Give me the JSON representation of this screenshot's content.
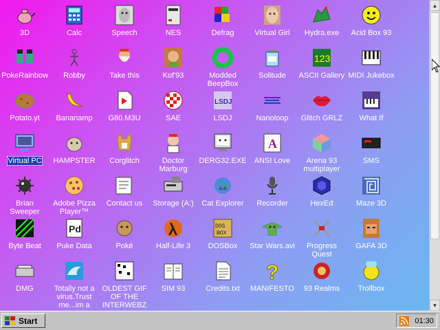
{
  "desktop": {
    "icons": [
      {
        "label": "3D",
        "icon": "teapot-icon"
      },
      {
        "label": "Calc",
        "icon": "calculator-icon"
      },
      {
        "label": "Speech",
        "icon": "speech-face-icon"
      },
      {
        "label": "NES",
        "icon": "nes-console-icon"
      },
      {
        "label": "Defrag",
        "icon": "defrag-icon"
      },
      {
        "label": "Virtual Girl",
        "icon": "girl-face-icon"
      },
      {
        "label": "Hydra.exe",
        "icon": "hydra-icon"
      },
      {
        "label": "Acid Box 93",
        "icon": "smiley-icon"
      },
      {
        "label": "PokeRainbow",
        "icon": "pixel-characters-icon"
      },
      {
        "label": "Robby",
        "icon": "stick-figure-icon"
      },
      {
        "label": "Take this",
        "icon": "bearded-man-icon"
      },
      {
        "label": "Kof'93",
        "icon": "fighter-portrait-icon"
      },
      {
        "label": "Modded BeepBox",
        "icon": "green-ring-icon"
      },
      {
        "label": "Solitude",
        "icon": "jar-icon"
      },
      {
        "label": "ASCII Gallery",
        "icon": "ascii-123-icon"
      },
      {
        "label": "MIDI Jukebox",
        "icon": "piano-keys-icon"
      },
      {
        "label": "Potato.yt",
        "icon": "potato-icon"
      },
      {
        "label": "Bananamp",
        "icon": "banana-icon"
      },
      {
        "label": "G80.M3U",
        "icon": "playlist-file-icon"
      },
      {
        "label": "SAE",
        "icon": "amiga-ball-icon"
      },
      {
        "label": "LSDJ",
        "icon": "lsdj-icon"
      },
      {
        "label": "Nanoloop",
        "icon": "nanoloop-icon"
      },
      {
        "label": "Glitch GRLZ",
        "icon": "lips-icon"
      },
      {
        "label": "What If",
        "icon": "piano-keyboard-icon"
      },
      {
        "label": "Virtual PC",
        "icon": "computer-icon",
        "selected": true
      },
      {
        "label": "HAMPSTER",
        "icon": "hamster-icon"
      },
      {
        "label": "Corglitch",
        "icon": "corgi-icon"
      },
      {
        "label": "Doctor Marburg",
        "icon": "doctor-icon"
      },
      {
        "label": "DERG32.EXE",
        "icon": "monitor-face-icon"
      },
      {
        "label": "ANSI Love",
        "icon": "ansi-letter-icon"
      },
      {
        "label": "Arena 93 multiplayer",
        "icon": "cube-icon"
      },
      {
        "label": "SMS",
        "icon": "sms-console-icon"
      },
      {
        "label": "Brian Sweeper",
        "icon": "mine-icon"
      },
      {
        "label": "Adobe Pizza Player™",
        "icon": "pizza-icon"
      },
      {
        "label": "Contact us",
        "icon": "contact-note-icon"
      },
      {
        "label": "Storage (A:)",
        "icon": "floppy-drive-icon"
      },
      {
        "label": "Cat Explorer",
        "icon": "cat-globe-icon"
      },
      {
        "label": "Recorder",
        "icon": "microphone-icon"
      },
      {
        "label": "HexEd",
        "icon": "hexed-icon"
      },
      {
        "label": "Maze 3D",
        "icon": "maze-icon"
      },
      {
        "label": "Byte Beat",
        "icon": "bytebeat-icon"
      },
      {
        "label": "Puke Data",
        "icon": "puke-data-icon"
      },
      {
        "label": "Poké",
        "icon": "pokemon-icon"
      },
      {
        "label": "Half-Life 3",
        "icon": "lambda-icon"
      },
      {
        "label": "DOSBox",
        "icon": "dosbox-icon"
      },
      {
        "label": "Star Wars.avi",
        "icon": "yoda-icon"
      },
      {
        "label": "Progress Quest",
        "icon": "crossed-swords-icon"
      },
      {
        "label": "GAFA 3D",
        "icon": "doomguy-icon"
      },
      {
        "label": "DMG",
        "icon": "dmg-icon"
      },
      {
        "label": "Totally not a virus.Trust me...im a",
        "icon": "dolphin-icon"
      },
      {
        "label": "OLDEST GIF OF THE INTERWEBZ",
        "icon": "old-gif-icon"
      },
      {
        "label": "SIM 93",
        "icon": "book-icon"
      },
      {
        "label": "Credits.txt",
        "icon": "text-file-icon"
      },
      {
        "label": "MANIFESTO",
        "icon": "question-mark-icon"
      },
      {
        "label": "93 Realms",
        "icon": "realms-icon"
      },
      {
        "label": "Trollbox",
        "icon": "trollbox-icon"
      }
    ]
  },
  "taskbar": {
    "start_label": "Start",
    "clock": "01:30",
    "tray_icon": "rss-feed-icon"
  },
  "colors": {
    "gradient_start": "#f318f0",
    "gradient_end": "#69b8f0",
    "taskbar": "#c3c3c3",
    "selection": "#1c3fb0"
  }
}
